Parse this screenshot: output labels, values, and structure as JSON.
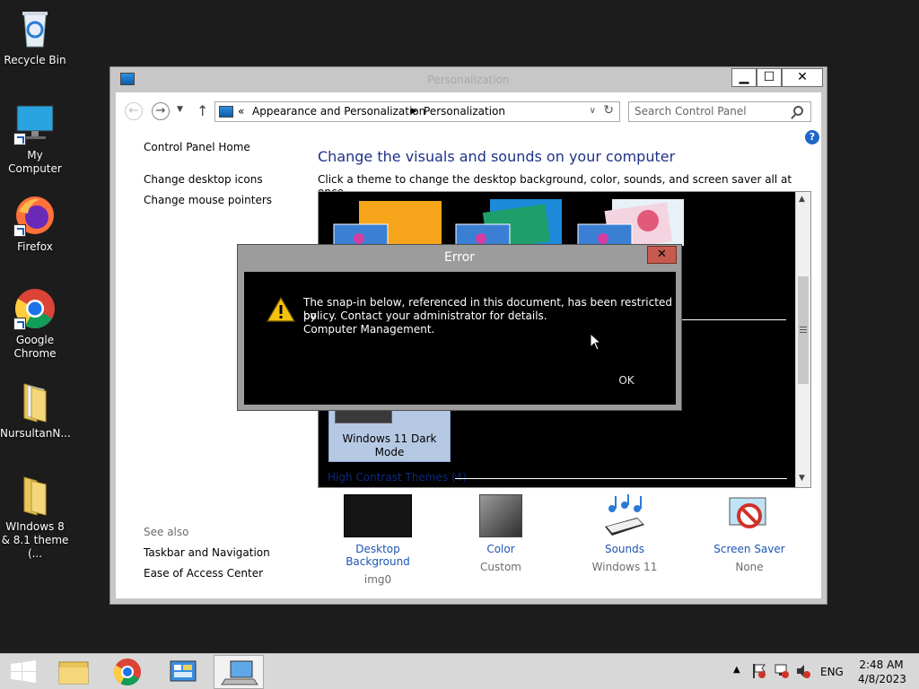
{
  "desktop": {
    "icons": [
      {
        "label": "Recycle Bin"
      },
      {
        "label": "My Computer"
      },
      {
        "label": "Firefox"
      },
      {
        "label": "Google Chrome"
      },
      {
        "label": "NursultanN..."
      },
      {
        "label": "WIndows 8 & 8.1 theme (..."
      }
    ]
  },
  "window": {
    "title": "Personalization",
    "buttons": {
      "minimize": "▁",
      "maximize": "☐",
      "close": "✕"
    },
    "address": {
      "prefix": "«",
      "crumbs": [
        "Appearance and Personalization",
        "Personalization"
      ]
    },
    "search": {
      "placeholder": "Search Control Panel"
    },
    "left_nav": {
      "home": "Control Panel Home",
      "links": [
        "Change desktop icons",
        "Change mouse pointers"
      ],
      "see_also_title": "See also",
      "see_also": [
        "Taskbar and Navigation",
        "Ease of Access Center"
      ]
    },
    "main": {
      "heading": "Change the visuals and sounds on your computer",
      "description": "Click a theme to change the desktop background, color, sounds, and screen saver all at once.",
      "themes": {
        "selected": "Windows 11 Dark Mode",
        "high_contrast": "High Contrast Themes (4)"
      },
      "bottom": [
        {
          "label": "Desktop Background",
          "value": "img0"
        },
        {
          "label": "Color",
          "value": "Custom"
        },
        {
          "label": "Sounds",
          "value": "Windows 11"
        },
        {
          "label": "Screen Saver",
          "value": "None"
        }
      ]
    }
  },
  "dialog": {
    "title": "Error",
    "close": "✕",
    "message_lines": [
      "The snap-in below, referenced in this document, has been restricted by",
      "policy. Contact your administrator for details.",
      "Computer Management."
    ],
    "ok": "OK",
    "icon": "warning-icon"
  },
  "taskbar": {
    "language": "ENG",
    "time": "2:48 AM",
    "date": "4/8/2023"
  },
  "colors": {
    "heading": "#1e3287",
    "link": "#1c55b4",
    "dialog_body": "#000000",
    "desktop": "#1c1c1c"
  }
}
